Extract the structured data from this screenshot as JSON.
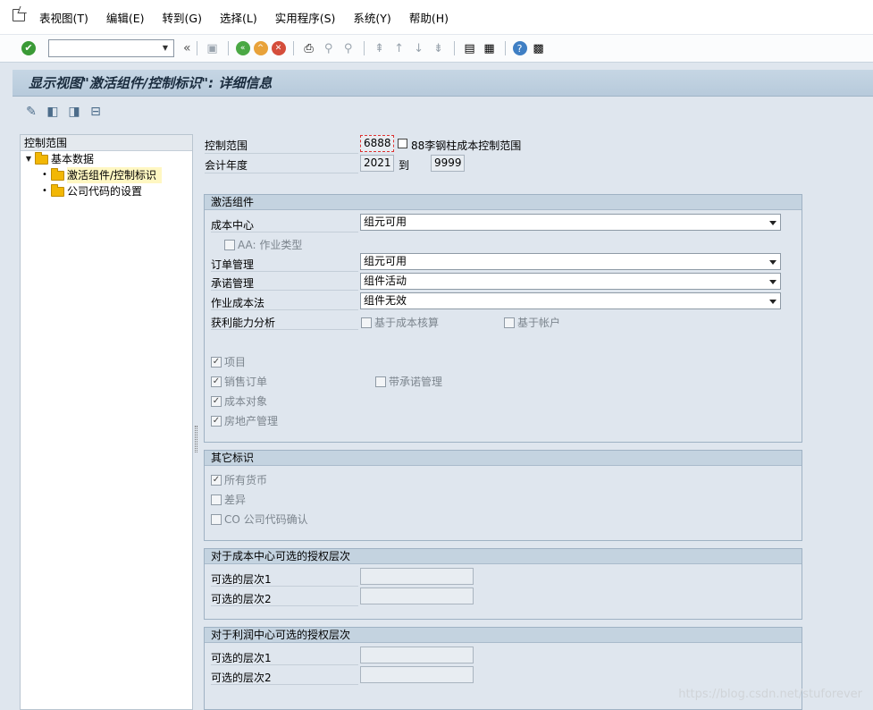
{
  "menu": [
    "表视图(T)",
    "编辑(E)",
    "转到(G)",
    "选择(L)",
    "实用程序(S)",
    "系统(Y)",
    "帮助(H)"
  ],
  "title": "显示视图\"激活组件/控制标识\": 详细信息",
  "tree": {
    "header": "控制范围",
    "items": [
      {
        "label": "基本数据"
      },
      {
        "label": "激活组件/控制标识"
      },
      {
        "label": "公司代码的设置"
      }
    ]
  },
  "header_fields": {
    "controlling_area_label": "控制范围",
    "controlling_area_value": "6888",
    "controlling_area_desc": "88李钢柱成本控制范围",
    "fiscal_year_label": "会计年度",
    "fiscal_year_from": "2021",
    "to_label": "到",
    "fiscal_year_to": "9999"
  },
  "activation": {
    "title": "激活组件",
    "cost_center_label": "成本中心",
    "cost_center_value": "组元可用",
    "aa_label": "AA: 作业类型",
    "order_label": "订单管理",
    "order_value": "组元可用",
    "commitment_label": "承诺管理",
    "commitment_value": "组件活动",
    "abc_label": "作业成本法",
    "abc_value": "组件无效",
    "profitability_label": "获利能力分析",
    "costing_based_label": "基于成本核算",
    "account_based_label": "基于帐户",
    "projects_label": "项目",
    "sales_orders_label": "销售订单",
    "with_commitment_label": "带承诺管理",
    "cost_objects_label": "成本对象",
    "real_estate_label": "房地产管理"
  },
  "other": {
    "title": "其它标识",
    "all_currencies_label": "所有货币",
    "variance_label": "差异",
    "co_company_label": "CO 公司代码确认"
  },
  "cost_center_auth": {
    "title": "对于成本中心可选的授权层次",
    "level1_label": "可选的层次1",
    "level2_label": "可选的层次2"
  },
  "profit_center_auth": {
    "title": "对于利润中心可选的授权层次",
    "level1_label": "可选的层次1",
    "level2_label": "可选的层次2"
  },
  "watermark": "https://blog.csdn.net/stuforever"
}
